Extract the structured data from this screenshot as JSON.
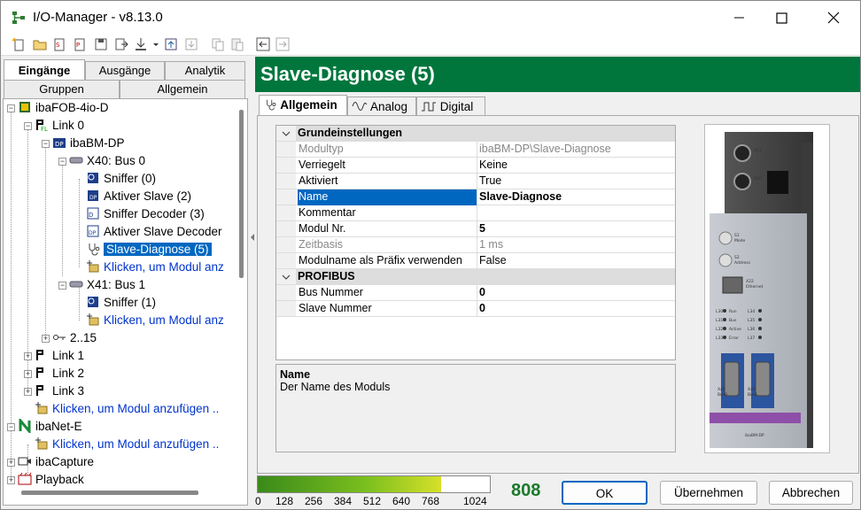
{
  "window": {
    "title": "I/O-Manager - v8.13.0"
  },
  "left_tabs": {
    "row1": [
      "Eingänge",
      "Ausgänge",
      "Analytik"
    ],
    "row2": [
      "Gruppen",
      "Allgemein"
    ]
  },
  "tree": [
    "ibaFOB-4io-D",
    "Link 0",
    "ibaBM-DP",
    "X40: Bus 0",
    "Sniffer (0)",
    "Aktiver Slave (2)",
    "Sniffer Decoder (3)",
    "Aktiver Slave Decoder",
    "Slave-Diagnose (5)",
    "Klicken, um Modul anz",
    "X41: Bus 1",
    "Sniffer (1)",
    "Klicken, um Modul anz",
    "2..15",
    "Link 1",
    "Link 2",
    "Link 3",
    "Klicken, um Modul anzufügen ..",
    "ibaNet-E",
    "Klicken, um Modul anzufügen ..",
    "ibaCapture",
    "Playback"
  ],
  "header": {
    "title": "Slave-Diagnose (5)"
  },
  "tabs": [
    "Allgemein",
    "Analog",
    "Digital"
  ],
  "props": {
    "cat1": "Grundeinstellungen",
    "rows1": [
      {
        "k": "Modultyp",
        "v": "ibaBM-DP\\Slave-Diagnose"
      },
      {
        "k": "Verriegelt",
        "v": "Keine"
      },
      {
        "k": "Aktiviert",
        "v": "True"
      },
      {
        "k": "Name",
        "v": "Slave-Diagnose"
      },
      {
        "k": "Kommentar",
        "v": ""
      },
      {
        "k": "Modul Nr.",
        "v": "5"
      },
      {
        "k": "Zeitbasis",
        "v": "1 ms"
      },
      {
        "k": "Modulname als Präfix verwenden",
        "v": "False"
      }
    ],
    "cat2": "PROFIBUS",
    "rows2": [
      {
        "k": "Bus Nummer",
        "v": "0"
      },
      {
        "k": "Slave Nummer",
        "v": "0"
      }
    ]
  },
  "description": {
    "title": "Name",
    "text": "Der Name des Moduls"
  },
  "device": {
    "labels": [
      "X11",
      "X10",
      "S1",
      "Mode",
      "S2",
      "Address",
      "X22",
      "Ethernet",
      "L30",
      "L31",
      "L32",
      "L33",
      "Run",
      "Bus",
      "Active",
      "Error",
      "L34",
      "L35",
      "L36",
      "L37",
      "X40",
      "Bus0",
      "X41",
      "Bus1",
      "ibaBM-DP"
    ]
  },
  "usage": {
    "ticks": [
      "0",
      "128",
      "256",
      "384",
      "512",
      "640",
      "768",
      "1024"
    ],
    "value": "808",
    "fraction": 0.79
  },
  "buttons": {
    "ok": "OK",
    "apply": "Übernehmen",
    "cancel": "Abbrechen"
  }
}
